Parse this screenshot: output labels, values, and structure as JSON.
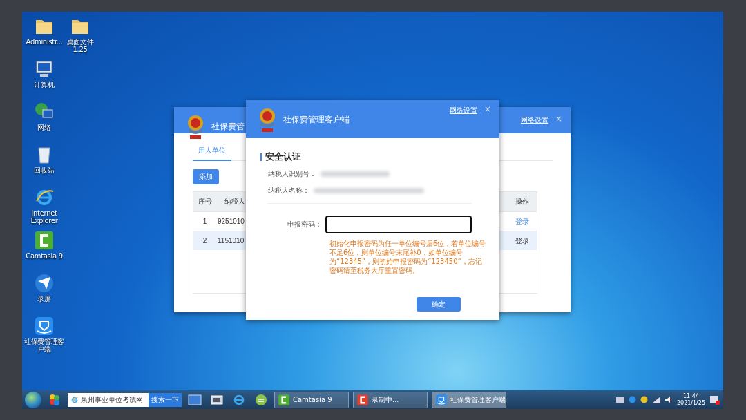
{
  "desktop_icons": [
    {
      "label": "Administr...",
      "kind": "folder"
    },
    {
      "label": "计算机",
      "kind": "computer"
    },
    {
      "label": "网络",
      "kind": "network"
    },
    {
      "label": "回收站",
      "kind": "recycle"
    },
    {
      "label": "Internet Explorer",
      "kind": "ie"
    },
    {
      "label": "Camtasia 9",
      "kind": "camtasia"
    },
    {
      "label": "录屏",
      "kind": "recorder"
    },
    {
      "label": "社保费管理客户端",
      "kind": "app"
    },
    {
      "label": "桌面文件 1.25",
      "kind": "folder"
    }
  ],
  "back_window": {
    "title": "社保费管",
    "link": "网络设置",
    "close": "×",
    "tab": {
      "label": "用人单位",
      "selected": true
    },
    "add_button": "添加",
    "table": {
      "columns": [
        "序号",
        "纳税人",
        "操作"
      ],
      "rows": [
        {
          "index": "1",
          "taxpayer": "9251010",
          "action": "登录",
          "selected": false
        },
        {
          "index": "2",
          "taxpayer": "1151010",
          "action": "登录",
          "selected": true
        }
      ]
    }
  },
  "dialog": {
    "title": "社保费管理客户端",
    "link": "网络设置",
    "close": "×",
    "section_title": "安全认证",
    "fields": [
      {
        "label": "纳税人识别号："
      },
      {
        "label": "纳税人名称："
      }
    ],
    "password": {
      "label": "申报密码："
    },
    "hint": "初始化申报密码为任一单位编号后6位，若单位编号不足6位，则单位编号末尾补0，如单位编号为“12345”，则初始申报密码为“123450”，忘记密码请至税务大厅重置密码。",
    "ok_button": "确定"
  },
  "taskbar": {
    "search_text": "泉州事业单位考试网",
    "search_button": "搜索一下",
    "tasks": [
      {
        "label": "Camtasia 9",
        "kind": "camtasia",
        "selected": false
      },
      {
        "label": "录制中...",
        "kind": "recorder",
        "selected": false
      },
      {
        "label": "社保费管理客户端",
        "kind": "app",
        "selected": true
      }
    ],
    "clock": {
      "time": "11:44",
      "date": "2021/1/25"
    }
  }
}
